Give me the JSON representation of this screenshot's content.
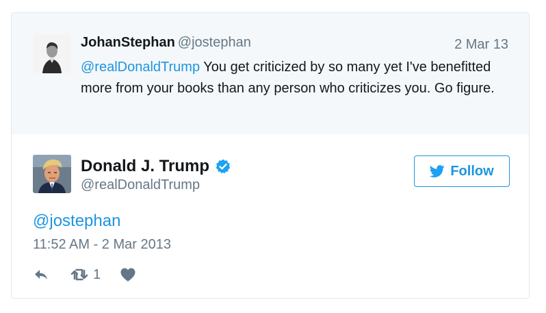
{
  "parent_tweet": {
    "display_name": "JohanStephan",
    "handle": "@jostephan",
    "date": "2 Mar 13",
    "mention": "@realDonaldTrump",
    "text": " You get criticized by so many yet I've benefitted more from your books than any person who criticizes you. Go figure."
  },
  "main_tweet": {
    "display_name": "Donald J. Trump",
    "handle": "@realDonaldTrump",
    "follow_label": "Follow",
    "text": "@jostephan",
    "timestamp": "11:52 AM - 2 Mar 2013",
    "retweet_count": "1"
  },
  "icons": {
    "verified": "verified-badge-icon",
    "follow": "twitter-bird-icon",
    "reply": "reply-icon",
    "retweet": "retweet-icon",
    "like": "heart-icon"
  },
  "colors": {
    "accent": "#1b95e0",
    "muted": "#657786",
    "text": "#14171a",
    "parent_bg": "#f5f8fa",
    "border": "#e1e8ed"
  }
}
